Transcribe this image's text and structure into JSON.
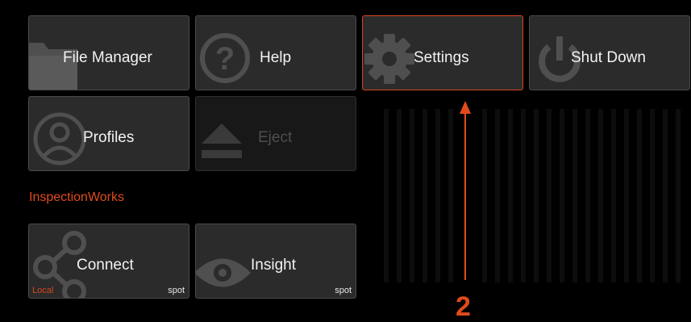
{
  "colors": {
    "accent": "#d9461e",
    "tile_bg": "#2b2b2b",
    "tile_border": "#4a4a4a",
    "icon_gray": "#4f4f4f",
    "text": "#f2f2f2"
  },
  "tiles": {
    "file_manager": {
      "label": "File Manager",
      "icon": "folder-icon"
    },
    "help": {
      "label": "Help",
      "icon": "question-circle-icon"
    },
    "settings": {
      "label": "Settings",
      "icon": "gear-icon",
      "state": "selected"
    },
    "shut_down": {
      "label": "Shut Down",
      "icon": "power-icon"
    },
    "profiles": {
      "label": "Profiles",
      "icon": "user-profile-icon"
    },
    "eject": {
      "label": "Eject",
      "icon": "eject-icon",
      "state": "disabled"
    }
  },
  "section": {
    "title": "InspectionWorks"
  },
  "inspection_tiles": {
    "connect": {
      "label": "Connect",
      "icon": "share-nodes-icon",
      "tag_left": "Local",
      "tag_right": "spot"
    },
    "insight": {
      "label": "Insight",
      "icon": "eye-icon",
      "tag_right": "spot"
    }
  },
  "annotation": {
    "text": "2",
    "icon": "callout-arrow-icon"
  }
}
